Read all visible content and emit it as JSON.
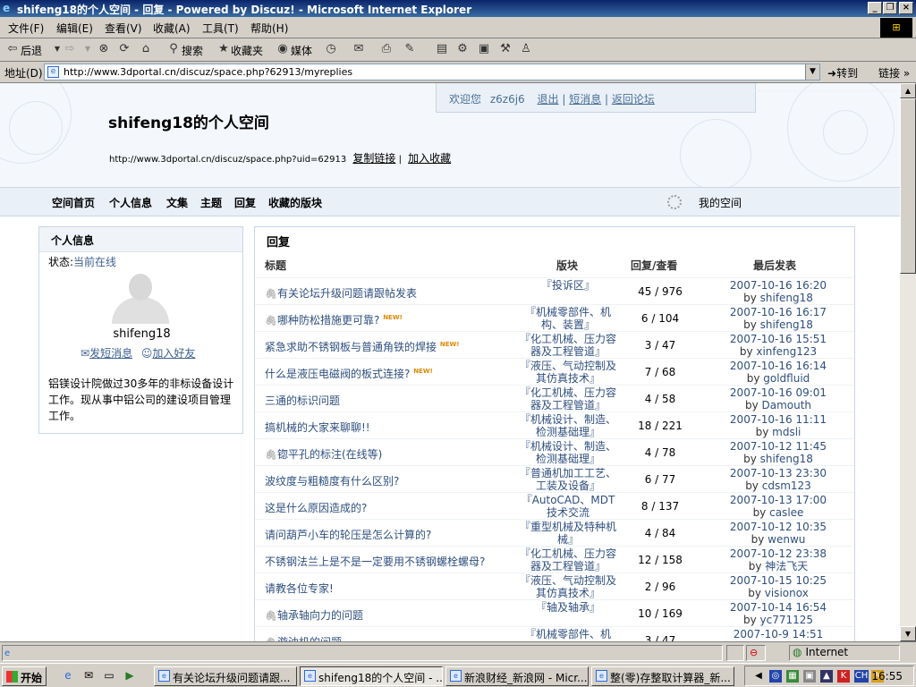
{
  "window": {
    "title": "shifeng18的个人空间 - 回复 - Powered by Discuz! - Microsoft Internet Explorer"
  },
  "menu": [
    "文件(F)",
    "编辑(E)",
    "查看(V)",
    "收藏(A)",
    "工具(T)",
    "帮助(H)"
  ],
  "toolbar": {
    "back": "后退",
    "search": "搜索",
    "favorites": "收藏夹",
    "media": "媒体"
  },
  "address": {
    "label": "地址(D)",
    "url": "http://www.3dportal.cn/discuz/space.php?62913/myreplies",
    "go": "转到",
    "links": "链接"
  },
  "space": {
    "title": "shifeng18的个人空间",
    "url": "http://www.3dportal.cn/discuz/space.php?uid=62913",
    "copy_link": "复制链接",
    "add_fav": "加入收藏",
    "welcome": "欢迎您",
    "user": "z6z6j6",
    "logout": "退出",
    "pm": "短消息",
    "back_forum": "返回论坛"
  },
  "nav": {
    "items": [
      "空间首页",
      "个人信息",
      "文集",
      "主题",
      "回复",
      "收藏的版块"
    ],
    "my_space": "我的空间"
  },
  "profile": {
    "heading": "个人信息",
    "status_label": "状态:",
    "status_value": "当前在线",
    "username": "shifeng18",
    "send_pm": "发短消息",
    "add_friend": "加入好友",
    "bio": "铝镁设计院做过30多年的非标设备设计工作。现从事中铝公司的建设项目管理工作。"
  },
  "replies": {
    "heading": "回复",
    "columns": [
      "标题",
      "版块",
      "回复/查看",
      "最后发表"
    ],
    "rows": [
      {
        "title": "有关论坛升级问题请跟帖发表",
        "clip": true,
        "new": false,
        "forum": "『投诉区』",
        "rv": "45 / 976",
        "date": "2007-10-16 16:20",
        "by_label": "by",
        "by": "shifeng18"
      },
      {
        "title": "哪种防松措施更可靠?",
        "clip": true,
        "new": true,
        "forum": "『机械零部件、机构、装置』",
        "rv": "6 / 104",
        "date": "2007-10-16 16:17",
        "by_label": "by",
        "by": "shifeng18"
      },
      {
        "title": "紧急求助不锈钢板与普通角铁的焊接",
        "clip": false,
        "new": true,
        "forum": "『化工机械、压力容器及工程管道』",
        "rv": "3 / 47",
        "date": "2007-10-16 15:51",
        "by_label": "by",
        "by": "xinfeng123"
      },
      {
        "title": "什么是液压电磁阀的板式连接?",
        "clip": false,
        "new": true,
        "forum": "『液压、气动控制及其仿真技术』",
        "rv": "7 / 68",
        "date": "2007-10-16 16:14",
        "by_label": "by",
        "by": "goldfluid"
      },
      {
        "title": "三通的标识问题",
        "clip": false,
        "new": false,
        "forum": "『化工机械、压力容器及工程管道』",
        "rv": "4 / 58",
        "date": "2007-10-16 09:01",
        "by_label": "by",
        "by": "Damouth"
      },
      {
        "title": "搞机械的大家来聊聊!!",
        "clip": false,
        "new": false,
        "forum": "『机械设计、制造、检测基础理』",
        "rv": "18 / 221",
        "date": "2007-10-16 11:11",
        "by_label": "by",
        "by": "mdsli"
      },
      {
        "title": "锪平孔的标注(在线等)",
        "clip": true,
        "new": false,
        "forum": "『机械设计、制造、检测基础理』",
        "rv": "4 / 78",
        "date": "2007-10-12 11:45",
        "by_label": "by",
        "by": "shifeng18"
      },
      {
        "title": "波纹度与粗糙度有什么区别?",
        "clip": false,
        "new": false,
        "forum": "『普通机加工工艺、工装及设备』",
        "rv": "6 / 77",
        "date": "2007-10-13 23:30",
        "by_label": "by",
        "by": "cdsm123"
      },
      {
        "title": "这是什么原因造成的?",
        "clip": false,
        "new": false,
        "forum": "『AutoCAD、MDT 技术交流",
        "rv": "8 / 137",
        "date": "2007-10-13 17:00",
        "by_label": "by",
        "by": "caslee"
      },
      {
        "title": "请问葫芦小车的轮压是怎么计算的?",
        "clip": false,
        "new": false,
        "forum": "『重型机械及特种机械』",
        "rv": "4 / 84",
        "date": "2007-10-12 10:35",
        "by_label": "by",
        "by": "wenwu"
      },
      {
        "title": "不锈钢法兰上是不是一定要用不锈钢螺栓螺母?",
        "clip": false,
        "new": false,
        "forum": "『化工机械、压力容器及工程管道』",
        "rv": "12 / 158",
        "date": "2007-10-12 23:38",
        "by_label": "by",
        "by": "神法飞天"
      },
      {
        "title": "请教各位专家!",
        "clip": false,
        "new": false,
        "forum": "『液压、气动控制及其仿真技术』",
        "rv": "2 / 96",
        "date": "2007-10-15 10:25",
        "by_label": "by",
        "by": "visionox"
      },
      {
        "title": "轴承轴向力的问题",
        "clip": true,
        "new": false,
        "forum": "『轴及轴承』",
        "rv": "10 / 169",
        "date": "2007-10-14 16:54",
        "by_label": "by",
        "by": "yc771125"
      },
      {
        "title": "游油机的问题",
        "clip": true,
        "new": false,
        "forum": "『机械零部件、机",
        "rv": "3 / 47",
        "date": "2007-10-9 14:51",
        "by_label": "by",
        "by": ""
      }
    ]
  },
  "statusbar": {
    "zone": "Internet"
  },
  "taskbar": {
    "start": "开始",
    "tasks": [
      "有关论坛升级问题请跟...",
      "shifeng18的个人空间 - ...",
      "新浪财经_新浪网 - Micr...",
      "整(零)存整取计算器_新..."
    ],
    "active_task": 1,
    "clock": "16:55"
  }
}
